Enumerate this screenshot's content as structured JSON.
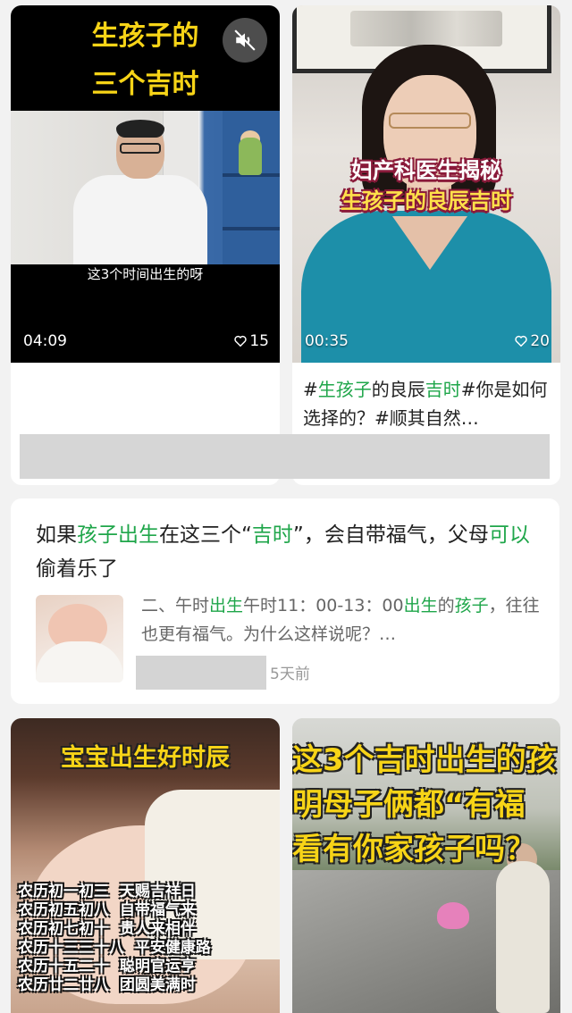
{
  "cards": [
    {
      "title_line1": "生孩子的",
      "title_line2": "三个吉时",
      "subtitle": "这3个时间出生的呀",
      "duration": "04:09",
      "likes": "15"
    },
    {
      "caption_line1": "妇产科医生揭秘",
      "caption_line2": "生孩子的良辰吉时",
      "duration": "00:35",
      "likes": "20",
      "text_parts": [
        "#",
        "生孩子",
        "的良辰",
        "吉时",
        "#你是如何选择的？#顺其自然…"
      ]
    }
  ],
  "article": {
    "title_parts": [
      "如果",
      "孩子出生",
      "在这三个“",
      "吉时",
      "”，会自带福气，父母",
      "可以",
      "偷着乐了"
    ],
    "snippet_parts": [
      "二、午时",
      "出生",
      "午时11：00-13：00",
      "出生",
      "的",
      "孩子",
      "，往往也更有福气。为什么这样说呢？…"
    ],
    "time": "5天前"
  },
  "bottom_cards": [
    {
      "title": "宝宝出生好时辰",
      "list": "农历初一初三  天赐吉祥日\n农历初五初八  自带福气来\n农历初七初十  贵人来相伴\n农历十三三十八  平安健康路\n农历十五二十  聪明官运亨\n农历廿二廿八  团圆美满时"
    },
    {
      "line1": "这3个吉时出生的孩",
      "line2": "明母子俩都“有福",
      "line3": "看有你家孩子吗？"
    }
  ],
  "icons": [
    "mute-icon",
    "heart-icon"
  ],
  "colors": {
    "highlight": "#1fa64a",
    "title_yellow": "#f7d417"
  }
}
